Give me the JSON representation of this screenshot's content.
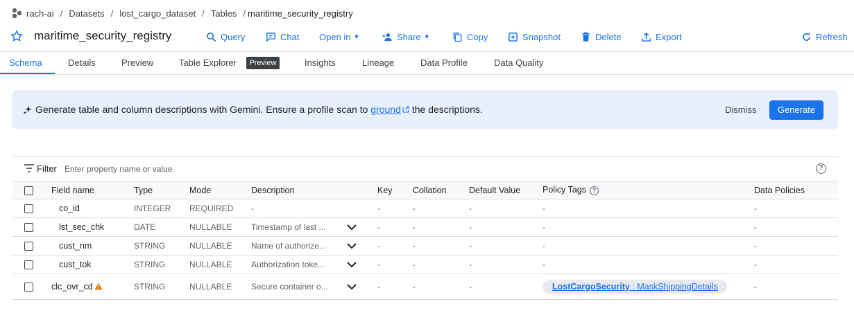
{
  "breadcrumb": {
    "project": "rach-ai",
    "datasets": "Datasets",
    "dataset": "lost_cargo_dataset",
    "tables": "Tables",
    "current": "maritime_security_registry",
    "separator": "/"
  },
  "header": {
    "title": "maritime_security_registry",
    "actions": {
      "query": "Query",
      "chat": "Chat",
      "open_in": "Open in",
      "share": "Share",
      "copy": "Copy",
      "snapshot": "Snapshot",
      "delete": "Delete",
      "export": "Export",
      "refresh": "Refresh"
    }
  },
  "tabs": {
    "schema": "Schema",
    "details": "Details",
    "preview": "Preview",
    "table_explorer": "Table Explorer",
    "table_explorer_badge": "Preview",
    "insights": "Insights",
    "lineage": "Lineage",
    "data_profile": "Data Profile",
    "data_quality": "Data Quality"
  },
  "banner": {
    "text_before": "Generate table and column descriptions with Gemini. Ensure a profile scan to",
    "link": "ground",
    "text_after": "the descriptions.",
    "dismiss": "Dismiss",
    "generate": "Generate"
  },
  "filter": {
    "label": "Filter",
    "placeholder": "Enter property name or value"
  },
  "table": {
    "headers": {
      "field_name": "Field name",
      "type": "Type",
      "mode": "Mode",
      "description": "Description",
      "key": "Key",
      "collation": "Collation",
      "default_value": "Default Value",
      "policy_tags": "Policy Tags",
      "data_policies": "Data Policies"
    },
    "rows": [
      {
        "name": "co_id",
        "type": "INTEGER",
        "mode": "REQUIRED",
        "description": "-",
        "key": "-",
        "collation": "-",
        "default": "-",
        "policy": "-",
        "data_policies": "-"
      },
      {
        "name": "lst_sec_chk",
        "type": "DATE",
        "mode": "NULLABLE",
        "description": "Timestamp of last ...",
        "key": "-",
        "collation": "-",
        "default": "-",
        "policy": "-",
        "data_policies": "-"
      },
      {
        "name": "cust_nm",
        "type": "STRING",
        "mode": "NULLABLE",
        "description": "Name of authorize...",
        "key": "-",
        "collation": "-",
        "default": "-",
        "policy": "-",
        "data_policies": "-"
      },
      {
        "name": "cust_tok",
        "type": "STRING",
        "mode": "NULLABLE",
        "description": "Authorization toke...",
        "key": "-",
        "collation": "-",
        "default": "-",
        "policy": "-",
        "data_policies": "-"
      },
      {
        "name": "clc_ovr_cd",
        "type": "STRING",
        "mode": "NULLABLE",
        "description": "Secure container o...",
        "key": "-",
        "collation": "-",
        "default": "-",
        "policy_tag_name": "LostCargoSecurity",
        "policy_tag_value": " : MaskShippingDetails",
        "data_policies": "-"
      }
    ]
  },
  "colors": {
    "accent": "#1a73e8",
    "banner_bg": "#e8f0fe",
    "divider": "#dadce0",
    "warning": "#e37400"
  }
}
